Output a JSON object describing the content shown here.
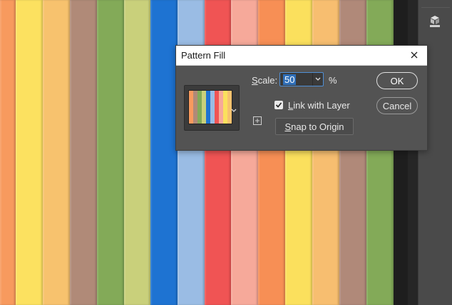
{
  "canvas": {
    "stripe_colors": [
      "#f79a5e",
      "#fce160",
      "#f7c26e",
      "#b08a78",
      "#83aa58",
      "#c9d07b",
      "#1e73d2",
      "#9abce4",
      "#f05454",
      "#f6a99a",
      "#f78f55",
      "#fbe05d",
      "#f7be70",
      "#b08979",
      "#83aa58"
    ],
    "stripe_widths": [
      22,
      38,
      38,
      38,
      38,
      37,
      38,
      38,
      37,
      38,
      38,
      38,
      38,
      38,
      38
    ]
  },
  "dialog": {
    "title": "Pattern Fill",
    "scale_label_first": "S",
    "scale_label_rest": "cale:",
    "scale_value": "50",
    "percent": "%",
    "link_label_first": "L",
    "link_label_rest": "ink with Layer",
    "link_checked": true,
    "snap_first": "S",
    "snap_rest": "nap to Origin",
    "ok_label": "OK",
    "cancel_label": "Cancel"
  },
  "swatch": {
    "colors": [
      "#f79a5e",
      "#b08a78",
      "#83aa58",
      "#c9d07b",
      "#1e73d2",
      "#9abce4",
      "#f05454",
      "#f6a99a",
      "#fbe05d",
      "#f7c26e"
    ]
  },
  "icons": {
    "close": "close-icon",
    "dropdown": "chevron-down-icon",
    "check": "check-icon",
    "plus": "add-preset-icon",
    "panel": "3d-cube-icon"
  }
}
